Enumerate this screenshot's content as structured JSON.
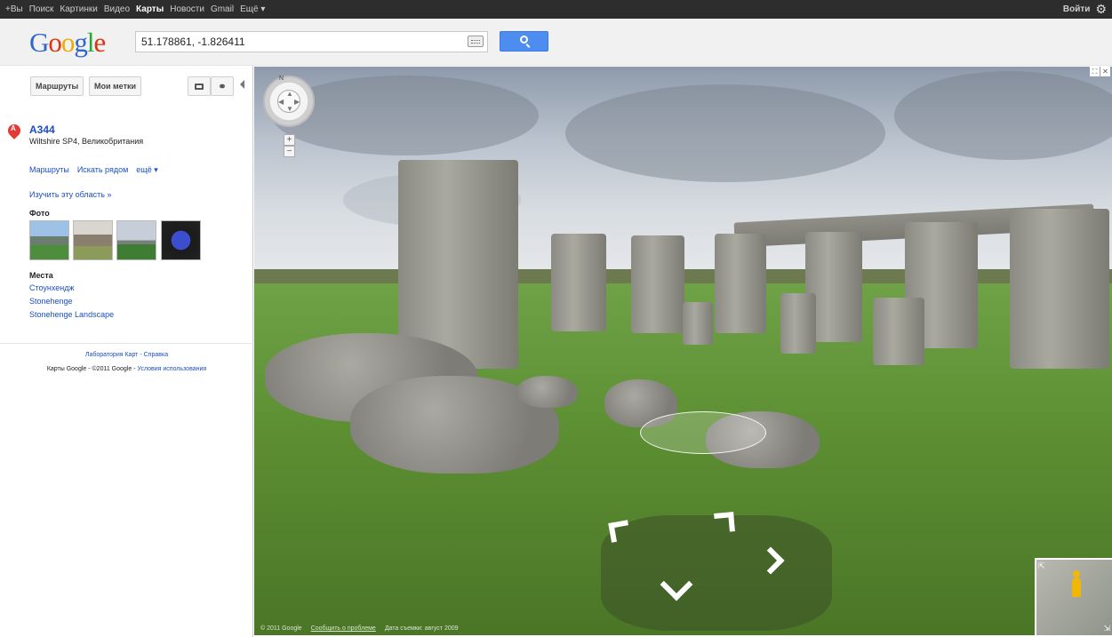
{
  "gbar": {
    "links": [
      "+Вы",
      "Поиск",
      "Картинки",
      "Видео",
      "Карты",
      "Новости",
      "Gmail",
      "Ещё ▾"
    ],
    "active": "Карты",
    "signin": "Войти"
  },
  "logo": {
    "text": "Google"
  },
  "search": {
    "value": "51.178861, -1.826411"
  },
  "panel": {
    "routes_btn": "Маршруты",
    "mymarks_btn": "Мои метки",
    "result": {
      "marker": "A",
      "title": "A344",
      "address": "Wiltshire SP4, Великобритания"
    },
    "actions": [
      "Маршруты",
      "Искать рядом",
      "ещё ▾"
    ],
    "explore": "Изучить эту область »",
    "photos_heading": "Фото",
    "places_heading": "Места",
    "places": [
      "Стоунхендж",
      "Stonehenge",
      "Stonehenge Landscape"
    ],
    "footer": {
      "lab": "Лаборатория Карт",
      "help": "Справка",
      "copyright": "Карты Google - ©2011 Google - ",
      "terms": "Условия использования"
    }
  },
  "streetview": {
    "compass_n": "N",
    "zoom_in": "+",
    "zoom_out": "−",
    "footer": {
      "copyright": "© 2011 Google",
      "report": "Сообщить о проблеме",
      "date": "Дата съемки: август 2009"
    }
  },
  "colors": {
    "link": "#1a4ec4",
    "gbar": "#2d2d2d",
    "search_button": "#4d8df0",
    "pin": "#e53935"
  }
}
